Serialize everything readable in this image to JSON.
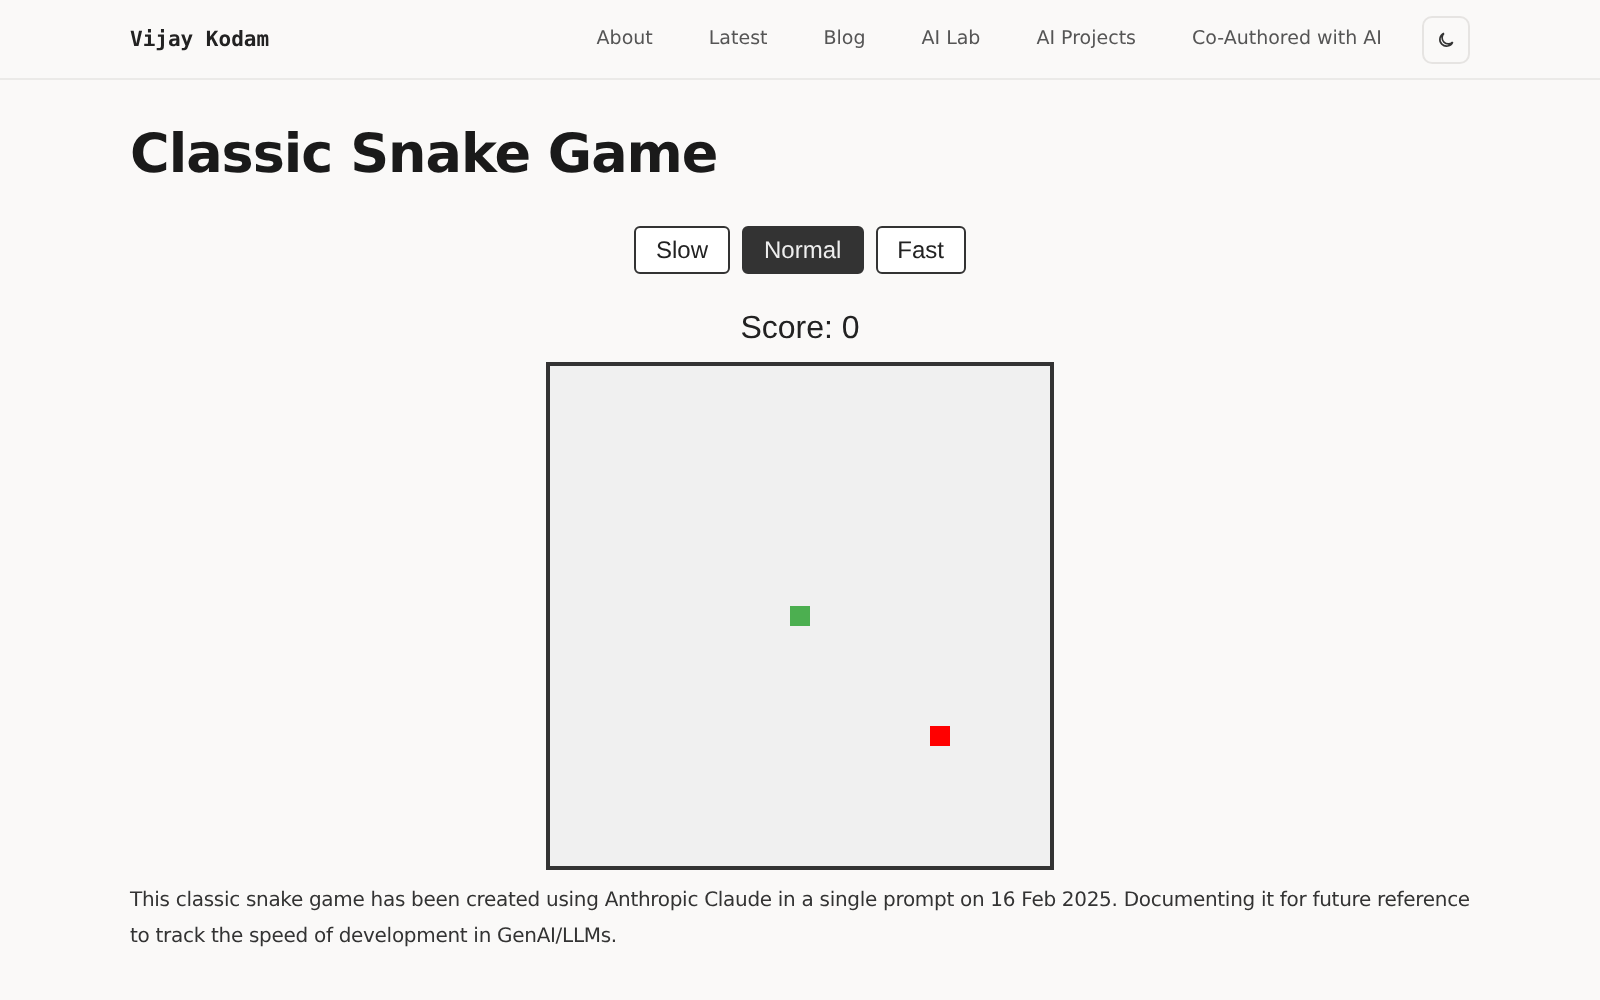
{
  "site_title": "Vijay Kodam",
  "nav": [
    {
      "label": "About"
    },
    {
      "label": "Latest"
    },
    {
      "label": "Blog"
    },
    {
      "label": "AI Lab"
    },
    {
      "label": "AI Projects"
    },
    {
      "label": "Co-Authored with AI"
    }
  ],
  "page_title": "Classic Snake Game",
  "speeds": [
    {
      "label": "Slow",
      "selected": false
    },
    {
      "label": "Normal",
      "selected": true
    },
    {
      "label": "Fast",
      "selected": false
    }
  ],
  "score": "Score: 0",
  "board": {
    "snake": [
      {
        "kind": "head"
      }
    ],
    "food": {
      "kind": "apple"
    }
  },
  "description": "This classic snake game has been created using Anthropic Claude in a single prompt on 16 Feb 2025. Documenting it for future reference to track the speed of development in GenAI/LLMs."
}
